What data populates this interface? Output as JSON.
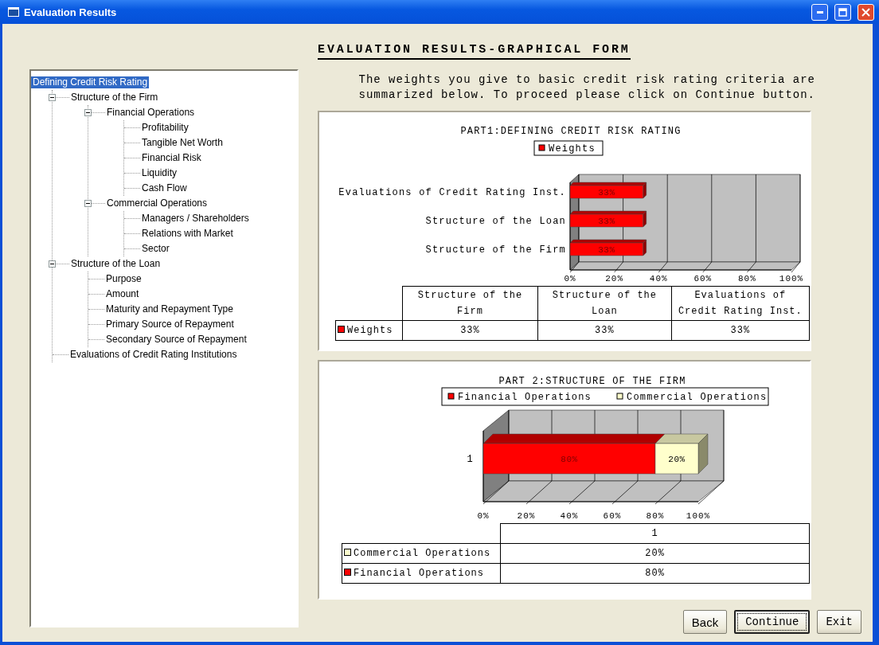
{
  "window": {
    "title": "Evaluation Results"
  },
  "tree": {
    "label": "Defining Credit Risk Rating",
    "selected": true,
    "children": [
      {
        "label": "Structure of the Firm",
        "selected": false,
        "expanded": true,
        "children": [
          {
            "label": "Financial Operations",
            "selected": false,
            "expanded": true,
            "children": [
              {
                "label": "Profitability",
                "selected": false
              },
              {
                "label": "Tangible Net Worth",
                "selected": false
              },
              {
                "label": "Financial Risk",
                "selected": false
              },
              {
                "label": "Liquidity",
                "selected": false
              },
              {
                "label": "Cash Flow",
                "selected": false
              }
            ]
          },
          {
            "label": "Commercial Operations",
            "selected": false,
            "expanded": true,
            "children": [
              {
                "label": "Managers / Shareholders",
                "selected": false
              },
              {
                "label": "Relations with Market",
                "selected": false
              },
              {
                "label": "Sector",
                "selected": false
              }
            ]
          }
        ]
      },
      {
        "label": "Structure of the Loan",
        "selected": false,
        "expanded": true,
        "children": [
          {
            "label": "Purpose",
            "selected": false
          },
          {
            "label": "Amount",
            "selected": false
          },
          {
            "label": "Maturity and Repayment Type",
            "selected": false
          },
          {
            "label": "Primary Source of Repayment",
            "selected": false
          },
          {
            "label": "Secondary Source of Repayment",
            "selected": false
          }
        ]
      },
      {
        "label": "Evaluations of Credit Rating Institutions",
        "selected": false
      }
    ]
  },
  "heading": "EVALUATION RESULTS-GRAPHICAL FORM",
  "description": "The weights you give to basic credit risk rating criteria are summarized below. To proceed please click on Continue button.",
  "panels": [
    {
      "chart_data": {
        "type": "bar",
        "orientation": "horizontal",
        "legend": "top",
        "title": "PART1:DEFINING CREDIT RISK RATING",
        "categories": [
          "Evaluations of Credit Rating Inst.",
          "Structure of the Loan",
          "Structure of the Firm"
        ],
        "series": [
          {
            "name": "Weights",
            "color": "#ff0000",
            "values": [
              33,
              33,
              33
            ]
          }
        ],
        "value_labels": [
          [
            "33%",
            "33%",
            "33%"
          ]
        ],
        "xlim": [
          0,
          100
        ],
        "xticks": [
          {
            "value": 0,
            "label": "0%"
          },
          {
            "value": 20,
            "label": "20%"
          },
          {
            "value": 40,
            "label": "40%"
          },
          {
            "value": 60,
            "label": "60%"
          },
          {
            "value": 80,
            "label": "80%"
          },
          {
            "value": 100,
            "label": "100%"
          }
        ]
      },
      "table": {
        "columns": [
          "Structure of the Firm",
          "Structure of the Loan",
          "Evaluations of Credit Rating Inst."
        ],
        "rows": [
          {
            "label": "Weights",
            "color": "#ff0000",
            "cells": [
              "33%",
              "33%",
              "33%"
            ]
          }
        ]
      }
    },
    {
      "chart_data": {
        "type": "bar",
        "orientation": "horizontal",
        "legend": "top",
        "stacked": true,
        "title": "PART 2:STRUCTURE OF THE FIRM",
        "categories": [
          "1"
        ],
        "series": [
          {
            "name": "Financial Operations",
            "color": "#ff0000",
            "values": [
              80
            ]
          },
          {
            "name": "Commercial Operations",
            "color": "#ffffcc",
            "values": [
              20
            ]
          }
        ],
        "value_labels": [
          [
            "80%"
          ],
          [
            "20%"
          ]
        ],
        "xlim": [
          0,
          100
        ],
        "xticks": [
          {
            "value": 0,
            "label": "0%"
          },
          {
            "value": 20,
            "label": "20%"
          },
          {
            "value": 40,
            "label": "40%"
          },
          {
            "value": 60,
            "label": "60%"
          },
          {
            "value": 80,
            "label": "80%"
          },
          {
            "value": 100,
            "label": "100%"
          }
        ]
      },
      "table": {
        "columns": [
          "1"
        ],
        "rows": [
          {
            "label": "Commercial Operations",
            "color": "#ffffcc",
            "cells": [
              "20%"
            ]
          },
          {
            "label": "Financial Operations",
            "color": "#ff0000",
            "cells": [
              "80%"
            ]
          }
        ]
      }
    }
  ],
  "buttons": [
    {
      "label": "Back",
      "kind": "plain",
      "default": false
    },
    {
      "label": "Continue",
      "kind": "mono",
      "default": true
    },
    {
      "label": "Exit",
      "kind": "mono",
      "default": false
    }
  ]
}
